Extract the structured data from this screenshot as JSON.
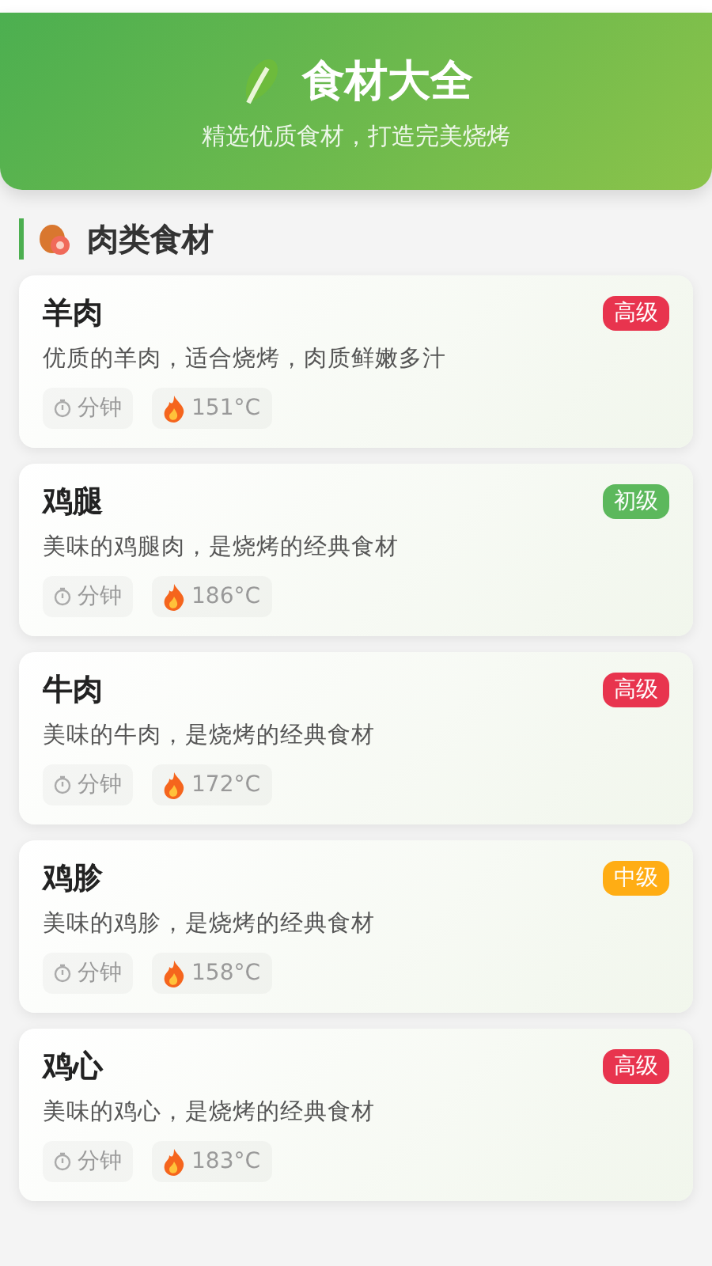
{
  "header": {
    "title": "食材大全",
    "subtitle": "精选优质食材，打造完美烧烤"
  },
  "section": {
    "title": "肉类食材"
  },
  "items": [
    {
      "name": "羊肉",
      "description": "优质的羊肉，适合烧烤，肉质鲜嫩多汁",
      "badge": {
        "text": "高级",
        "color": "#e8344e"
      },
      "time": "分钟",
      "temperature": "151°C"
    },
    {
      "name": "鸡腿",
      "description": "美味的鸡腿肉，是烧烤的经典食材",
      "badge": {
        "text": "初级",
        "color": "#5cb85c"
      },
      "time": "分钟",
      "temperature": "186°C"
    },
    {
      "name": "牛肉",
      "description": "美味的牛肉，是烧烤的经典食材",
      "badge": {
        "text": "高级",
        "color": "#e8344e"
      },
      "time": "分钟",
      "temperature": "172°C"
    },
    {
      "name": "鸡胗",
      "description": "美味的鸡胗，是烧烤的经典食材",
      "badge": {
        "text": "中级",
        "color": "#ffad14"
      },
      "time": "分钟",
      "temperature": "158°C"
    },
    {
      "name": "鸡心",
      "description": "美味的鸡心，是烧烤的经典食材",
      "badge": {
        "text": "高级",
        "color": "#e8344e"
      },
      "time": "分钟",
      "temperature": "183°C"
    }
  ]
}
